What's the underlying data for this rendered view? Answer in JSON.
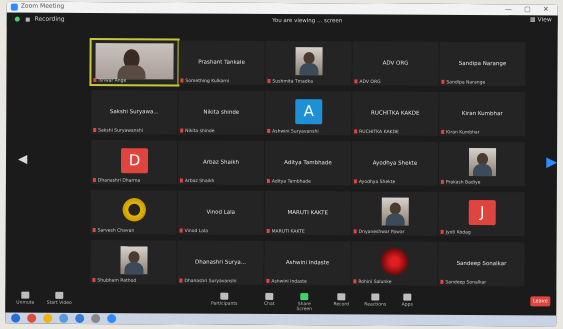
{
  "window": {
    "title": "Zoom Meeting"
  },
  "topbar": {
    "recording_label": "Recording",
    "view_label": "View",
    "viewing_text": "You are viewing ... screen"
  },
  "participants": [
    {
      "id": "p1",
      "name": "",
      "label": "Ishwar Ange",
      "avatar_color": "",
      "avatar_letter": "",
      "kind": "video-woman"
    },
    {
      "id": "p2",
      "name": "Prashant Tankale",
      "label": "Something Kulkarni",
      "avatar_color": "",
      "avatar_letter": "",
      "kind": "name"
    },
    {
      "id": "p3",
      "name": "",
      "label": "Sushmita Tmadka",
      "avatar_color": "",
      "avatar_letter": "",
      "kind": "photo"
    },
    {
      "id": "p4",
      "name": "ADV ORG",
      "label": "ADV ORG",
      "avatar_color": "",
      "avatar_letter": "",
      "kind": "name"
    },
    {
      "id": "p5",
      "name": "Sandipa Narange",
      "label": "Sandipa Narange",
      "avatar_color": "",
      "avatar_letter": "",
      "kind": "name"
    },
    {
      "id": "p6",
      "name": "Sakshi Suryawa...",
      "label": "Sakshi Suryawanshi",
      "avatar_color": "",
      "avatar_letter": "",
      "kind": "name"
    },
    {
      "id": "p7",
      "name": "Nikita shinde",
      "label": "Nikita shinde",
      "avatar_color": "",
      "avatar_letter": "",
      "kind": "name"
    },
    {
      "id": "p8",
      "name": "",
      "label": "Ashwini Suryavanshi",
      "avatar_color": "#1e90d6",
      "avatar_letter": "A",
      "kind": "avatar"
    },
    {
      "id": "p9",
      "name": "RUCHITKA KAKDE",
      "label": "RUCHITKA KAKDE",
      "avatar_color": "",
      "avatar_letter": "",
      "kind": "name"
    },
    {
      "id": "p10",
      "name": "Kiran Kumbhar",
      "label": "Kiran Kumbhar",
      "avatar_color": "",
      "avatar_letter": "",
      "kind": "name"
    },
    {
      "id": "p11",
      "name": "",
      "label": "Dhanashri Dharma",
      "avatar_color": "#e0443e",
      "avatar_letter": "D",
      "kind": "avatar"
    },
    {
      "id": "p12",
      "name": "Arbaz Shaikh",
      "label": "Arbaz Shaikh",
      "avatar_color": "",
      "avatar_letter": "",
      "kind": "name"
    },
    {
      "id": "p13",
      "name": "Aditya Tambhade",
      "label": "Aditya Tambhade",
      "avatar_color": "",
      "avatar_letter": "",
      "kind": "name"
    },
    {
      "id": "p14",
      "name": "Ayodhya Shekte",
      "label": "Ayodhya Shekte",
      "avatar_color": "",
      "avatar_letter": "",
      "kind": "name"
    },
    {
      "id": "p15",
      "name": "",
      "label": "Prakash Badiye",
      "avatar_color": "",
      "avatar_letter": "",
      "kind": "photo"
    },
    {
      "id": "p16",
      "name": "",
      "label": "Sarvesh Chavan",
      "avatar_color": "",
      "avatar_letter": "",
      "kind": "flower"
    },
    {
      "id": "p17",
      "name": "Vinod Lala",
      "label": "Vinod Lala",
      "avatar_color": "",
      "avatar_letter": "",
      "kind": "name"
    },
    {
      "id": "p18",
      "name": "MARUTI KAKTE",
      "label": "MARUTI KAKTE",
      "avatar_color": "",
      "avatar_letter": "",
      "kind": "name"
    },
    {
      "id": "p19",
      "name": "",
      "label": "Dnyaneshwar Pawar",
      "avatar_color": "",
      "avatar_letter": "",
      "kind": "photo"
    },
    {
      "id": "p20",
      "name": "",
      "label": "Jyoti Kodag",
      "avatar_color": "#e0443e",
      "avatar_letter": "J",
      "kind": "avatar"
    },
    {
      "id": "p21",
      "name": "",
      "label": "Shubham Rathod",
      "avatar_color": "",
      "avatar_letter": "",
      "kind": "photo"
    },
    {
      "id": "p22",
      "name": "Dhanashri Surya...",
      "label": "Dhanashri Suryavanshi",
      "avatar_color": "",
      "avatar_letter": "",
      "kind": "name"
    },
    {
      "id": "p23",
      "name": "Ashwini Indaste",
      "label": "Ashwini Indaste",
      "avatar_color": "",
      "avatar_letter": "",
      "kind": "name"
    },
    {
      "id": "p24",
      "name": "",
      "label": "Rohini Salunke",
      "avatar_color": "",
      "avatar_letter": "",
      "kind": "red-photo"
    },
    {
      "id": "p25",
      "name": "Sandeep Sonalkar",
      "label": "Sandeep Sonalkar",
      "avatar_color": "",
      "avatar_letter": "",
      "kind": "name"
    }
  ],
  "toolbar": {
    "items": [
      {
        "label": "Unmute"
      },
      {
        "label": "Start Video"
      },
      {
        "label": "Participants"
      },
      {
        "label": "Chat"
      },
      {
        "label": "Share Screen"
      },
      {
        "label": "Record"
      },
      {
        "label": "Reactions"
      },
      {
        "label": "Apps"
      }
    ],
    "end_label": "Leave"
  },
  "colors": {
    "accent": "#2d8cff",
    "danger": "#e0443e",
    "tile_bg": "#242424",
    "app_bg": "#1b1b1b"
  }
}
